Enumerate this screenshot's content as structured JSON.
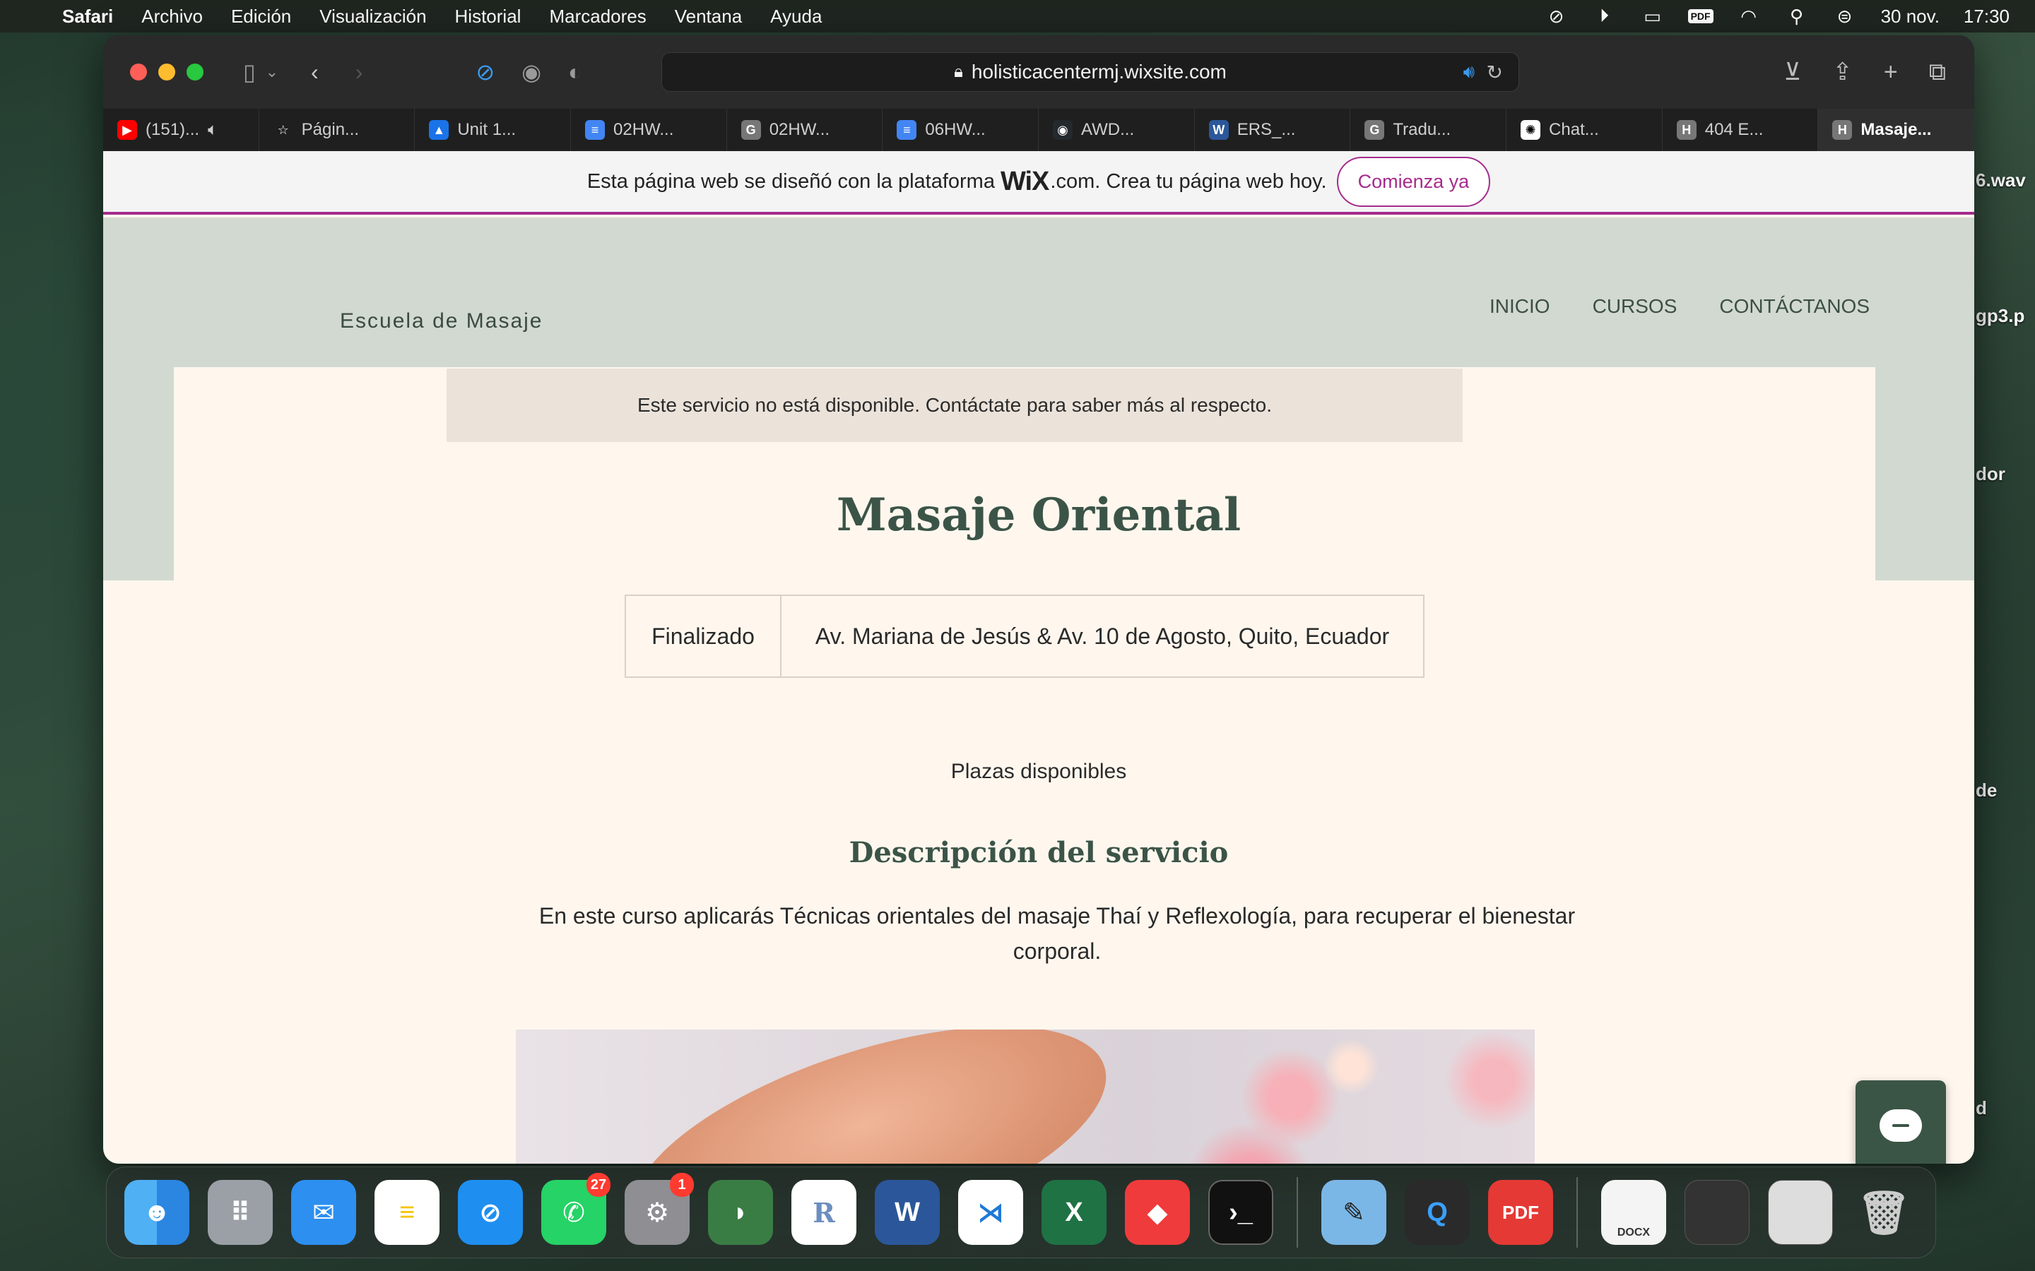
{
  "menubar": {
    "app": "Safari",
    "items": [
      "Archivo",
      "Edición",
      "Visualización",
      "Historial",
      "Marcadores",
      "Ventana",
      "Ayuda"
    ],
    "pdf_label": "PDF",
    "date": "30 nov.",
    "time": "17:30"
  },
  "toolbar": {
    "url": "holisticacentermj.wixsite.com"
  },
  "tabs": [
    {
      "label": "(151)...",
      "icon_color": "#ff0000",
      "icon_text": "▶"
    },
    {
      "label": "Págin...",
      "icon_color": "transparent",
      "icon_text": "☆"
    },
    {
      "label": "Unit 1...",
      "icon_color": "#1a73e8",
      "icon_text": "▲"
    },
    {
      "label": "02HW...",
      "icon_color": "#4285f4",
      "icon_text": "≡"
    },
    {
      "label": "02HW...",
      "icon_color": "#777",
      "icon_text": "G"
    },
    {
      "label": "06HW...",
      "icon_color": "#4285f4",
      "icon_text": "≡"
    },
    {
      "label": "AWD...",
      "icon_color": "#24292e",
      "icon_text": "◉"
    },
    {
      "label": "ERS_...",
      "icon_color": "#2b579a",
      "icon_text": "W"
    },
    {
      "label": "Tradu...",
      "icon_color": "#777",
      "icon_text": "G"
    },
    {
      "label": "Chat...",
      "icon_color": "#fff",
      "icon_text": "✺"
    },
    {
      "label": "404 E...",
      "icon_color": "#777",
      "icon_text": "H"
    },
    {
      "label": "Masaje...",
      "icon_color": "#777",
      "icon_text": "H"
    }
  ],
  "wixbar": {
    "text_before": "Esta página web se diseñó con la plataforma",
    "wix": "WiX",
    "text_after": ".com. Crea tu página web hoy.",
    "cta": "Comienza ya"
  },
  "site": {
    "brand": "Escuela de Masaje",
    "nav": [
      "INICIO",
      "CURSOS",
      "CONTÁCTANOS"
    ]
  },
  "service": {
    "notice": "Este servicio no está disponible. Contáctate para saber más al respecto.",
    "title": "Masaje Oriental",
    "status": "Finalizado",
    "address": "Av. Mariana de Jesús & Av. 10 de Agosto, Quito, Ecuador",
    "spots": "Plazas disponibles",
    "desc_title": "Descripción del servicio",
    "description": "En este curso aplicarás Técnicas orientales del masaje Thaí y Reflexología, para recuperar el bienestar corporal."
  },
  "desktop_labels": [
    "6.wav",
    "gp3.p",
    "dor",
    "de",
    "d"
  ],
  "dock": {
    "whatsapp_badge": "27",
    "settings_badge": "1",
    "pdf_label": "PDF",
    "docx_label": "DOCX"
  }
}
